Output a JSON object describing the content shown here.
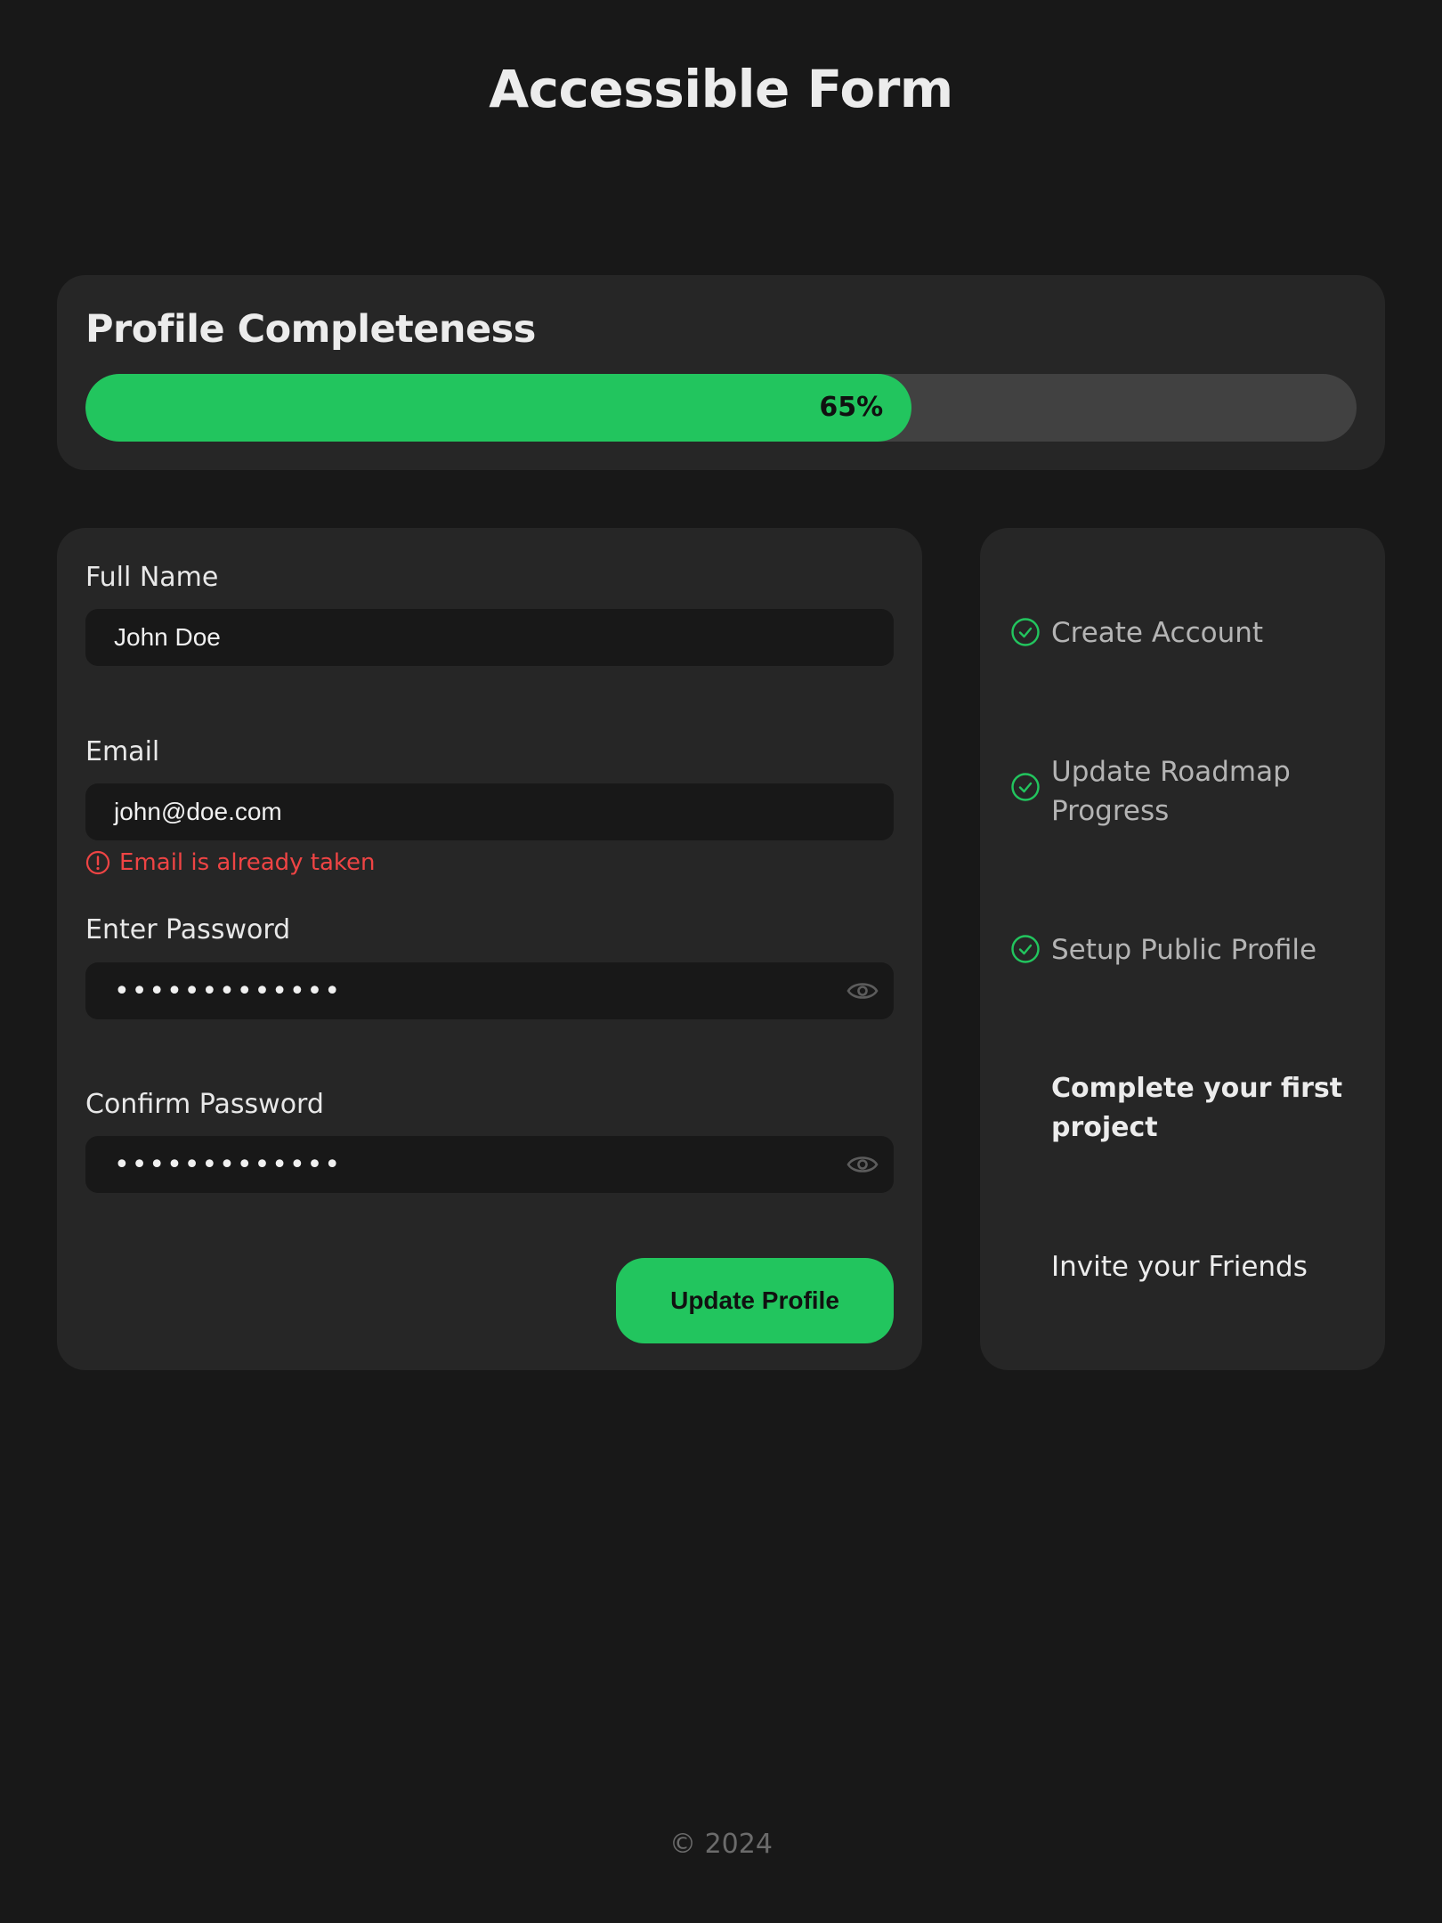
{
  "page": {
    "title": "Accessible Form",
    "footer": "© 2024"
  },
  "colors": {
    "accent": "#22c55e",
    "error": "#ef4444",
    "background": "#181818",
    "card": "#262626"
  },
  "progress": {
    "heading": "Profile Completeness",
    "value": 65,
    "label": "65%"
  },
  "form": {
    "full_name": {
      "label": "Full Name",
      "value": "John Doe"
    },
    "email": {
      "label": "Email",
      "value": "john@doe.com",
      "error": "Email is already taken",
      "error_icon": "alert-circle-icon"
    },
    "password": {
      "label": "Enter Password",
      "value": "•••••••••••••",
      "toggle_icon": "eye-icon"
    },
    "confirm_password": {
      "label": "Confirm Password",
      "value": "•••••••••••••",
      "toggle_icon": "eye-icon"
    },
    "submit_label": "Update Profile"
  },
  "roadmap": {
    "items": [
      {
        "label": "Create Account",
        "status": "done",
        "icon": "check-circle-icon"
      },
      {
        "label": "Update Roadmap Progress",
        "status": "done",
        "icon": "check-circle-icon"
      },
      {
        "label": "Setup Public Profile",
        "status": "done",
        "icon": "check-circle-icon"
      },
      {
        "label": "Complete your first project",
        "status": "current"
      },
      {
        "label": "Invite your Friends",
        "status": "pending"
      }
    ]
  }
}
